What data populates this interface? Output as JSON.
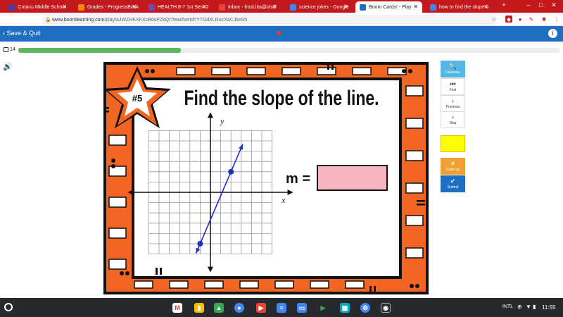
{
  "browser": {
    "tabs": [
      {
        "title": "Ontario Middle School",
        "icon": "school-favicon",
        "color": "#4a3fa0"
      },
      {
        "title": "Grades - ProgressBook",
        "icon": "progressbook-favicon",
        "color": "#f08a00"
      },
      {
        "title": "HEALTH 8-7 1st Sem 2",
        "icon": "classroom-favicon",
        "color": "#7248b9"
      },
      {
        "title": "Inbox - frost.lita@olsd",
        "icon": "gmail-favicon",
        "color": "#ea4335"
      },
      {
        "title": "science jokes - Google",
        "icon": "google-favicon",
        "color": "#4285f4"
      },
      {
        "title": "Boom Cards! - Play",
        "icon": "boom-favicon",
        "color": "#1e6fc1"
      },
      {
        "title": "how to find the slope o",
        "icon": "google-favicon",
        "color": "#4285f4"
      }
    ],
    "active_tab": 5,
    "url_host": "www.boomlearning.com",
    "url_path": "/play/aJWZHKXFXcB6sPZkQ/?teacherId=Y7GdXLRucXaCJ8xSh",
    "accent": "#c3191c"
  },
  "appbar": {
    "save_label": "Save & Quit",
    "color": "#1e6fc1"
  },
  "progress": {
    "card_count": "14",
    "fraction": 0.3,
    "color": "#5cb85c"
  },
  "card": {
    "badge": "#5",
    "title": "Find the slope of the line.",
    "y_label": "y",
    "x_label": "x",
    "m_label": "m =",
    "answer_value": "",
    "frame_color": "#f26522",
    "answer_color": "#f7b6bd",
    "line_color": "#1f2fc7",
    "point1": [
      -1,
      -5
    ],
    "point2": [
      2,
      2
    ]
  },
  "side": {
    "overview": "Overview",
    "first": "First",
    "previous": "Previous",
    "skip": "Skip",
    "clear": "Clear up",
    "submit": "Submit"
  },
  "shelf": {
    "keyboard": "INTL",
    "time": "11:55"
  }
}
